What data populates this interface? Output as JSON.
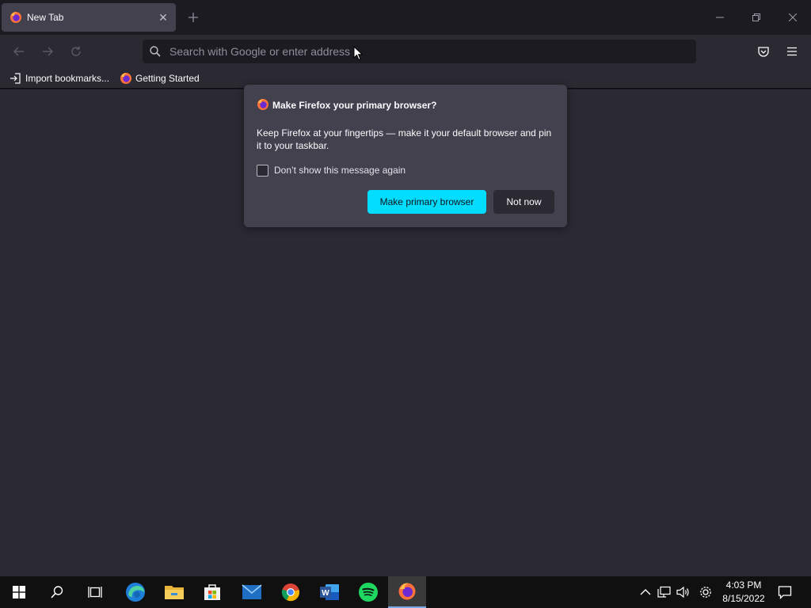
{
  "tab": {
    "title": "New Tab",
    "close_glyph": "✕"
  },
  "new_tab_glyph": "+",
  "window_controls": {
    "minimize": "minimize-icon",
    "restore": "restore-icon",
    "close": "close-icon"
  },
  "navbar": {
    "back": "back-arrow-icon",
    "forward": "forward-arrow-icon",
    "reload": "reload-icon",
    "url_placeholder": "Search with Google or enter address",
    "pocket": "pocket-icon",
    "menu": "hamburger-menu-icon"
  },
  "bookmarks": [
    {
      "label": "Import bookmarks...",
      "icon": "import-icon"
    },
    {
      "label": "Getting Started",
      "icon": "firefox-icon"
    }
  ],
  "dialog": {
    "title": "Make Firefox your primary browser?",
    "body": "Keep Firefox at your fingertips — make it your default browser and pin it to your taskbar.",
    "checkbox_label": "Don’t show this message again",
    "checkbox_checked": false,
    "primary_button": "Make primary browser",
    "secondary_button": "Not now"
  },
  "taskbar": {
    "apps": [
      "start-icon",
      "search-icon",
      "task-view-icon",
      "edge-icon",
      "file-explorer-icon",
      "microsoft-store-icon",
      "mail-icon",
      "chrome-icon",
      "word-icon",
      "spotify-icon",
      "firefox-icon"
    ],
    "active_app": "firefox-icon",
    "tray": [
      "chevron-up-icon",
      "network-icon",
      "volume-icon",
      "settings-icon"
    ],
    "time": "4:03 PM",
    "date": "8/15/2022",
    "notifications": "notifications-icon"
  },
  "colors": {
    "accent": "#00ddff",
    "background": "#2b2a33",
    "dialog": "#42414d",
    "tabstrip": "#1c1b22"
  }
}
